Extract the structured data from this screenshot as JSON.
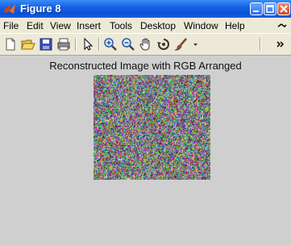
{
  "window": {
    "title": "Figure 8"
  },
  "menu": [
    "File",
    "Edit",
    "View",
    "Insert",
    "Tools",
    "Desktop",
    "Window",
    "Help"
  ],
  "toolbar": {
    "icons": [
      "new-file-icon",
      "open-folder-icon",
      "save-icon",
      "print-icon",
      "select-arrow-icon",
      "zoom-in-icon",
      "zoom-out-icon",
      "pan-hand-icon",
      "rotate-3d-icon",
      "brush-icon",
      "dropdown-arrow-icon",
      "overflow-chevron-icon"
    ]
  },
  "axes": {
    "title": "Reconstructed Image with RGB Arranged",
    "image_description": "random color noise image"
  },
  "colors": {
    "titlebar": "#1761e6",
    "menu_bg": "#ece9d8",
    "figure_bg": "#cfcfcf"
  }
}
